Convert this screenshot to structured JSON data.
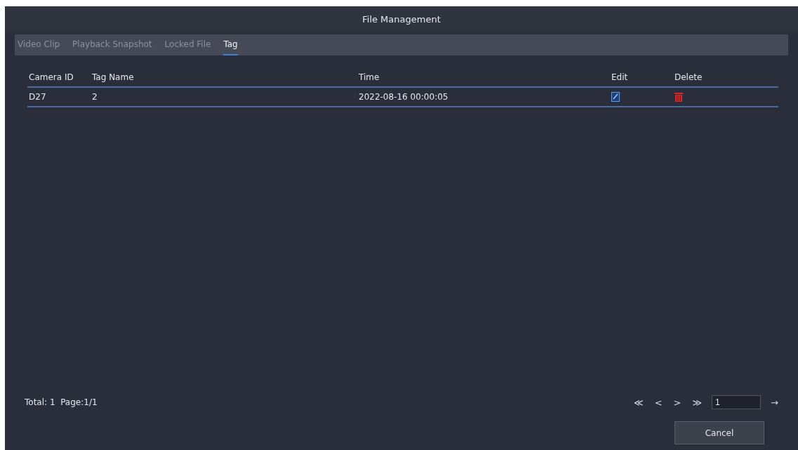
{
  "window": {
    "title": "File Management"
  },
  "tabs": [
    {
      "label": "Video Clip",
      "selected": false
    },
    {
      "label": "Playback Snapshot",
      "selected": false
    },
    {
      "label": "Locked File",
      "selected": false
    },
    {
      "label": "Tag",
      "selected": true
    }
  ],
  "table": {
    "columns": [
      "Camera ID",
      "Tag Name",
      "Time",
      "Edit",
      "Delete"
    ],
    "rows": [
      {
        "camera_id": "D27",
        "tag_name": "2",
        "time": "2022-08-16 00:00:05"
      }
    ]
  },
  "footer": {
    "summary": "Total: 1  Page:1/1",
    "pager": [
      "≪",
      "<",
      ">",
      "≫"
    ],
    "page_input": "1",
    "go": "→"
  },
  "buttons": [
    "Cancel"
  ]
}
